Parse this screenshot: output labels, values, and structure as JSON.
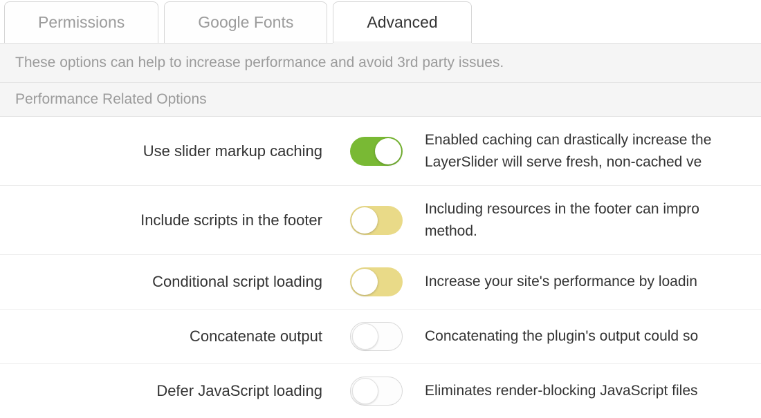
{
  "tabs": [
    {
      "label": "Permissions",
      "active": false
    },
    {
      "label": "Google Fonts",
      "active": false
    },
    {
      "label": "Advanced",
      "active": true
    }
  ],
  "description": "These options can help to increase performance and avoid 3rd party issues.",
  "section_header": "Performance Related Options",
  "options": [
    {
      "label": "Use slider markup caching",
      "state": "on",
      "color": "green",
      "desc": "Enabled caching can drastically increase the\nLayerSlider will serve fresh, non-cached ve"
    },
    {
      "label": "Include scripts in the footer",
      "state": "on-left",
      "color": "yellow",
      "desc": "Including resources in the footer can impro\nmethod."
    },
    {
      "label": "Conditional script loading",
      "state": "on-left",
      "color": "yellow",
      "desc": "Increase your site's performance by loadin"
    },
    {
      "label": "Concatenate output",
      "state": "off",
      "color": "off",
      "desc": "Concatenating the plugin's output could so"
    },
    {
      "label": "Defer JavaScript loading",
      "state": "off",
      "color": "off",
      "desc": "Eliminates render-blocking JavaScript files"
    }
  ]
}
